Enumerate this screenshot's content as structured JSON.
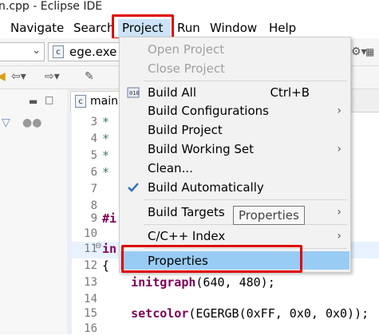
{
  "window": {
    "title": "n.cpp - Eclipse IDE"
  },
  "menubar": {
    "items": [
      {
        "label": "Navigate"
      },
      {
        "label": "Search"
      },
      {
        "label": "Project"
      },
      {
        "label": "Run"
      },
      {
        "label": "Window"
      },
      {
        "label": "Help"
      }
    ]
  },
  "toolbar": {
    "launch_target": "ege.exe"
  },
  "editor": {
    "tab_label": "main.",
    "lines": [
      {
        "num": "3",
        "text": "*"
      },
      {
        "num": "4",
        "text": "*"
      },
      {
        "num": "5",
        "text": "*"
      },
      {
        "num": "6",
        "text": "*"
      },
      {
        "num": "7",
        "text": ""
      },
      {
        "num": "8",
        "text": ""
      },
      {
        "num": "9",
        "text": "#i"
      },
      {
        "num": "10",
        "text": ""
      },
      {
        "num": "11",
        "text": "in"
      },
      {
        "num": "12",
        "text": "{"
      },
      {
        "num": "13",
        "text": "    initgraph(640, 480);"
      },
      {
        "num": "14",
        "text": ""
      },
      {
        "num": "15",
        "text": "    setcolor(EGERGB(0xFF, 0x0, 0x0));"
      },
      {
        "num": "16",
        "text": ""
      }
    ]
  },
  "project_menu": {
    "open_project": "Open Project",
    "close_project": "Close Project",
    "build_all": "Build All",
    "build_all_shortcut": "Ctrl+B",
    "build_configurations": "Build Configurations",
    "build_project": "Build Project",
    "build_working_set": "Build Working Set",
    "clean": "Clean...",
    "build_automatically": "Build Automatically",
    "build_targets": "Build Targets",
    "cpp_index": "C/C++ Index",
    "properties": "Properties"
  },
  "tooltip": {
    "text": "Properties"
  },
  "colors": {
    "highlight": "#99ccf5",
    "annotation_red": "#e00000",
    "keyword": "#7f0055",
    "comment": "#3f7f5f"
  }
}
